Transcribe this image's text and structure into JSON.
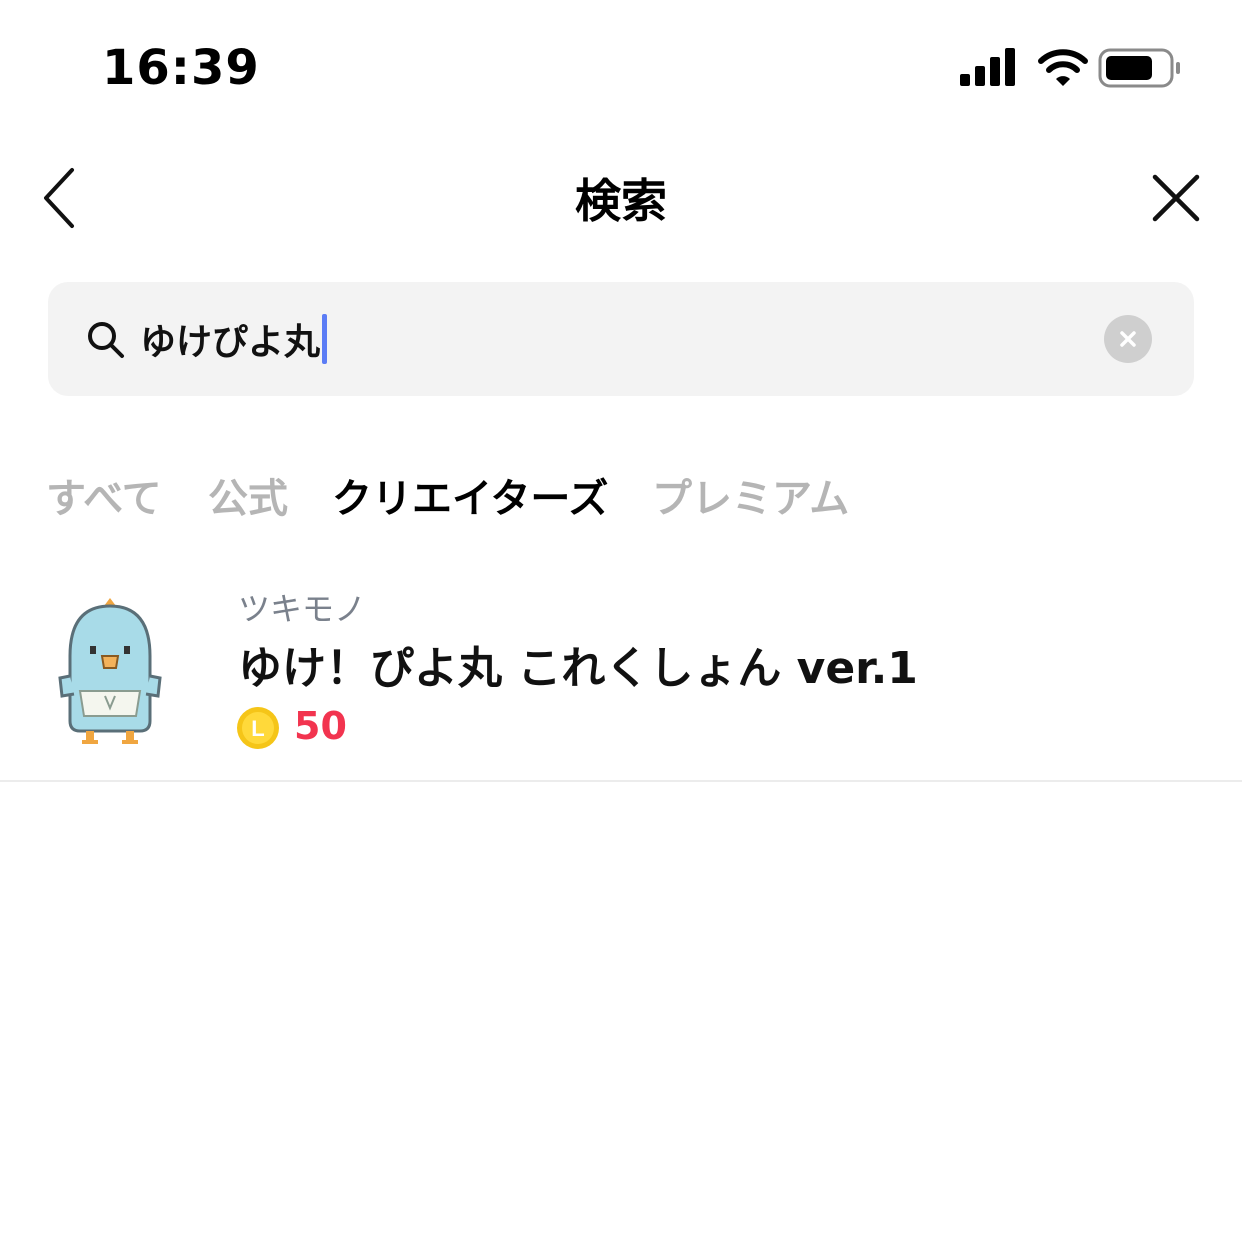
{
  "status_bar": {
    "time": "16:39",
    "icons": [
      "signal-icon",
      "wifi-icon",
      "battery-icon"
    ]
  },
  "header": {
    "title": "検索",
    "back_icon": "chevron-left-icon",
    "close_icon": "close-icon"
  },
  "search": {
    "query": "ゆけぴよ丸",
    "icon": "search-icon",
    "clear_icon": "clear-icon"
  },
  "tabs": [
    {
      "label": "すべて",
      "active": false
    },
    {
      "label": "公式",
      "active": false
    },
    {
      "label": "クリエイターズ",
      "active": true
    },
    {
      "label": "プレミアム",
      "active": false
    }
  ],
  "results": [
    {
      "creator": "ツキモノ",
      "title": "ゆけ！ぴよ丸 これくしょん ver.1",
      "price": "50",
      "coin_letter": "L"
    }
  ],
  "colors": {
    "accent_caret": "#5b7cf5",
    "price": "#f2344f",
    "tab_inactive": "#b5b5b5",
    "tab_active": "#000000",
    "search_bg": "#f3f3f3",
    "coin": "#f5c518"
  }
}
